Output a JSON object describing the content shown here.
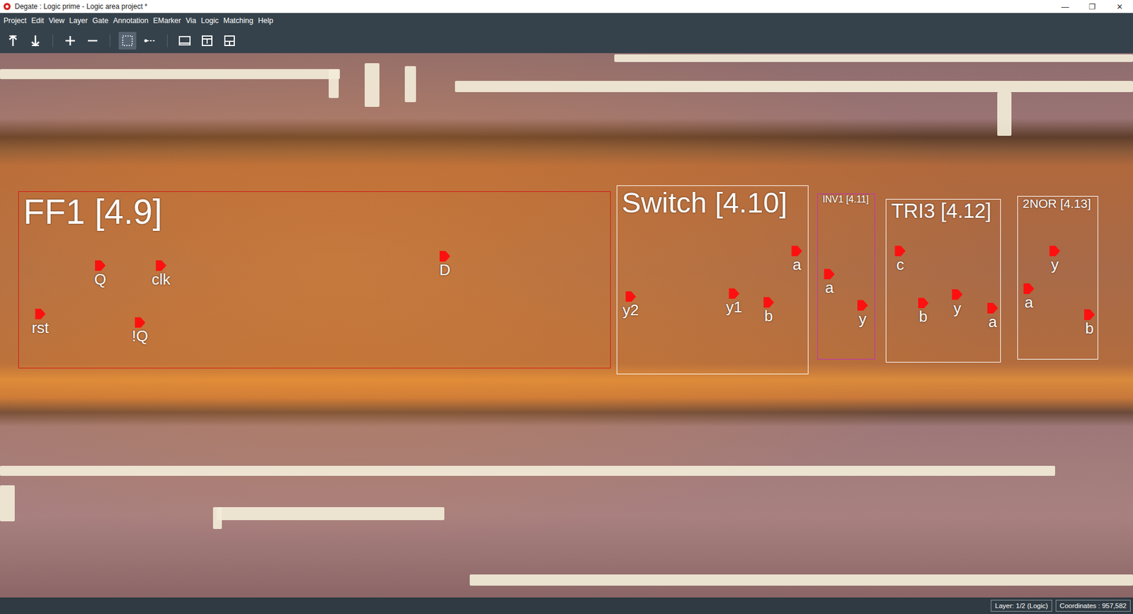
{
  "window": {
    "title": "Degate : Logic prime - Logic area project *",
    "controls": [
      "—",
      "❐",
      "✕"
    ]
  },
  "menu": [
    "Project",
    "Edit",
    "View",
    "Layer",
    "Gate",
    "Annotation",
    "EMarker",
    "Via",
    "Logic",
    "Matching",
    "Help"
  ],
  "toolbar": [
    {
      "kind": "up",
      "selected": false
    },
    {
      "kind": "down",
      "selected": false
    },
    {
      "kind": "add",
      "selected": false
    },
    {
      "kind": "remove",
      "selected": false
    },
    {
      "kind": "select",
      "selected": true
    },
    {
      "kind": "wire",
      "selected": false
    },
    {
      "kind": "view",
      "selected": false
    },
    {
      "kind": "text",
      "selected": false
    },
    {
      "kind": "layout",
      "selected": false
    }
  ],
  "gates": [
    {
      "name": "FF1 [4.9]",
      "color": "#d01818",
      "ports": [
        {
          "label": "Q"
        },
        {
          "label": "rst"
        },
        {
          "label": "clk"
        },
        {
          "label": "!Q"
        },
        {
          "label": "D"
        }
      ]
    },
    {
      "name": "Switch [4.10]",
      "color": "#ffffff",
      "ports": [
        {
          "label": "y2"
        },
        {
          "label": "y1"
        },
        {
          "label": "b"
        },
        {
          "label": "a"
        }
      ]
    },
    {
      "name": "INV1 [4.11]",
      "color": "#c030c0",
      "ports": [
        {
          "label": "a"
        },
        {
          "label": "y"
        }
      ]
    },
    {
      "name": "TRI3 [4.12]",
      "color": "#ffffff",
      "ports": [
        {
          "label": "c"
        },
        {
          "label": "b"
        },
        {
          "label": "y"
        },
        {
          "label": "a"
        }
      ]
    },
    {
      "name": "2NOR [4.13]",
      "color": "#ffffff",
      "ports": [
        {
          "label": "y"
        },
        {
          "label": "a"
        },
        {
          "label": "b"
        }
      ]
    }
  ],
  "status_bar": {
    "layer": "Layer: 1/2 (Logic)",
    "coordinates": "Coordinates : 957,582"
  }
}
